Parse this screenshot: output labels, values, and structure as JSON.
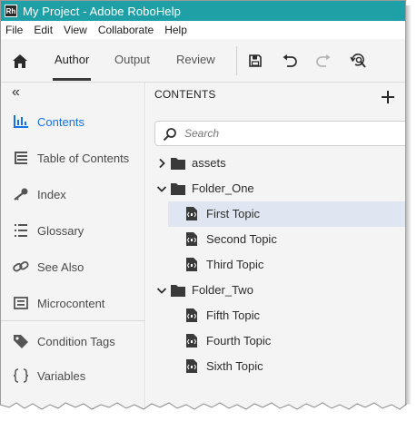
{
  "window": {
    "title": "My Project - Adobe RoboHelp",
    "app_icon_text": "Rh"
  },
  "menu": [
    "File",
    "Edit",
    "View",
    "Collaborate",
    "Help"
  ],
  "toolbar": {
    "tabs": [
      "Author",
      "Output",
      "Review"
    ],
    "active_tab": "Author",
    "icons": [
      "home-icon",
      "save-icon",
      "undo-icon",
      "redo-icon",
      "review-search-icon"
    ]
  },
  "sidebar": {
    "collapse_glyph": "«",
    "items": [
      {
        "label": "Contents",
        "icon": "contents-icon",
        "active": true
      },
      {
        "label": "Table of Contents",
        "icon": "toc-icon",
        "active": false
      },
      {
        "label": "Index",
        "icon": "key-icon",
        "active": false
      },
      {
        "label": "Glossary",
        "icon": "glossary-icon",
        "active": false
      },
      {
        "label": "See Also",
        "icon": "link-icon",
        "active": false
      },
      {
        "label": "Microcontent",
        "icon": "microcontent-icon",
        "active": false
      },
      {
        "label": "Condition Tags",
        "icon": "tag-icon",
        "active": false
      },
      {
        "label": "Variables",
        "icon": "braces-icon",
        "active": false
      }
    ]
  },
  "contents": {
    "title": "CONTENTS",
    "search_placeholder": "Search",
    "tree": [
      {
        "label": "assets",
        "type": "folder",
        "expanded": false
      },
      {
        "label": "Folder_One",
        "type": "folder",
        "expanded": true
      },
      {
        "label": "First Topic",
        "type": "topic",
        "selected": true
      },
      {
        "label": "Second Topic",
        "type": "topic"
      },
      {
        "label": "Third Topic",
        "type": "topic"
      },
      {
        "label": "Folder_Two",
        "type": "folder",
        "expanded": true
      },
      {
        "label": "Fifth Topic",
        "type": "topic"
      },
      {
        "label": "Fourth Topic",
        "type": "topic"
      },
      {
        "label": "Sixth Topic",
        "type": "topic"
      }
    ]
  },
  "colors": {
    "titlebar": "#1fa0a6",
    "accent": "#1473e6",
    "selection": "#dfe6f1",
    "panel": "#f4f4f4"
  }
}
